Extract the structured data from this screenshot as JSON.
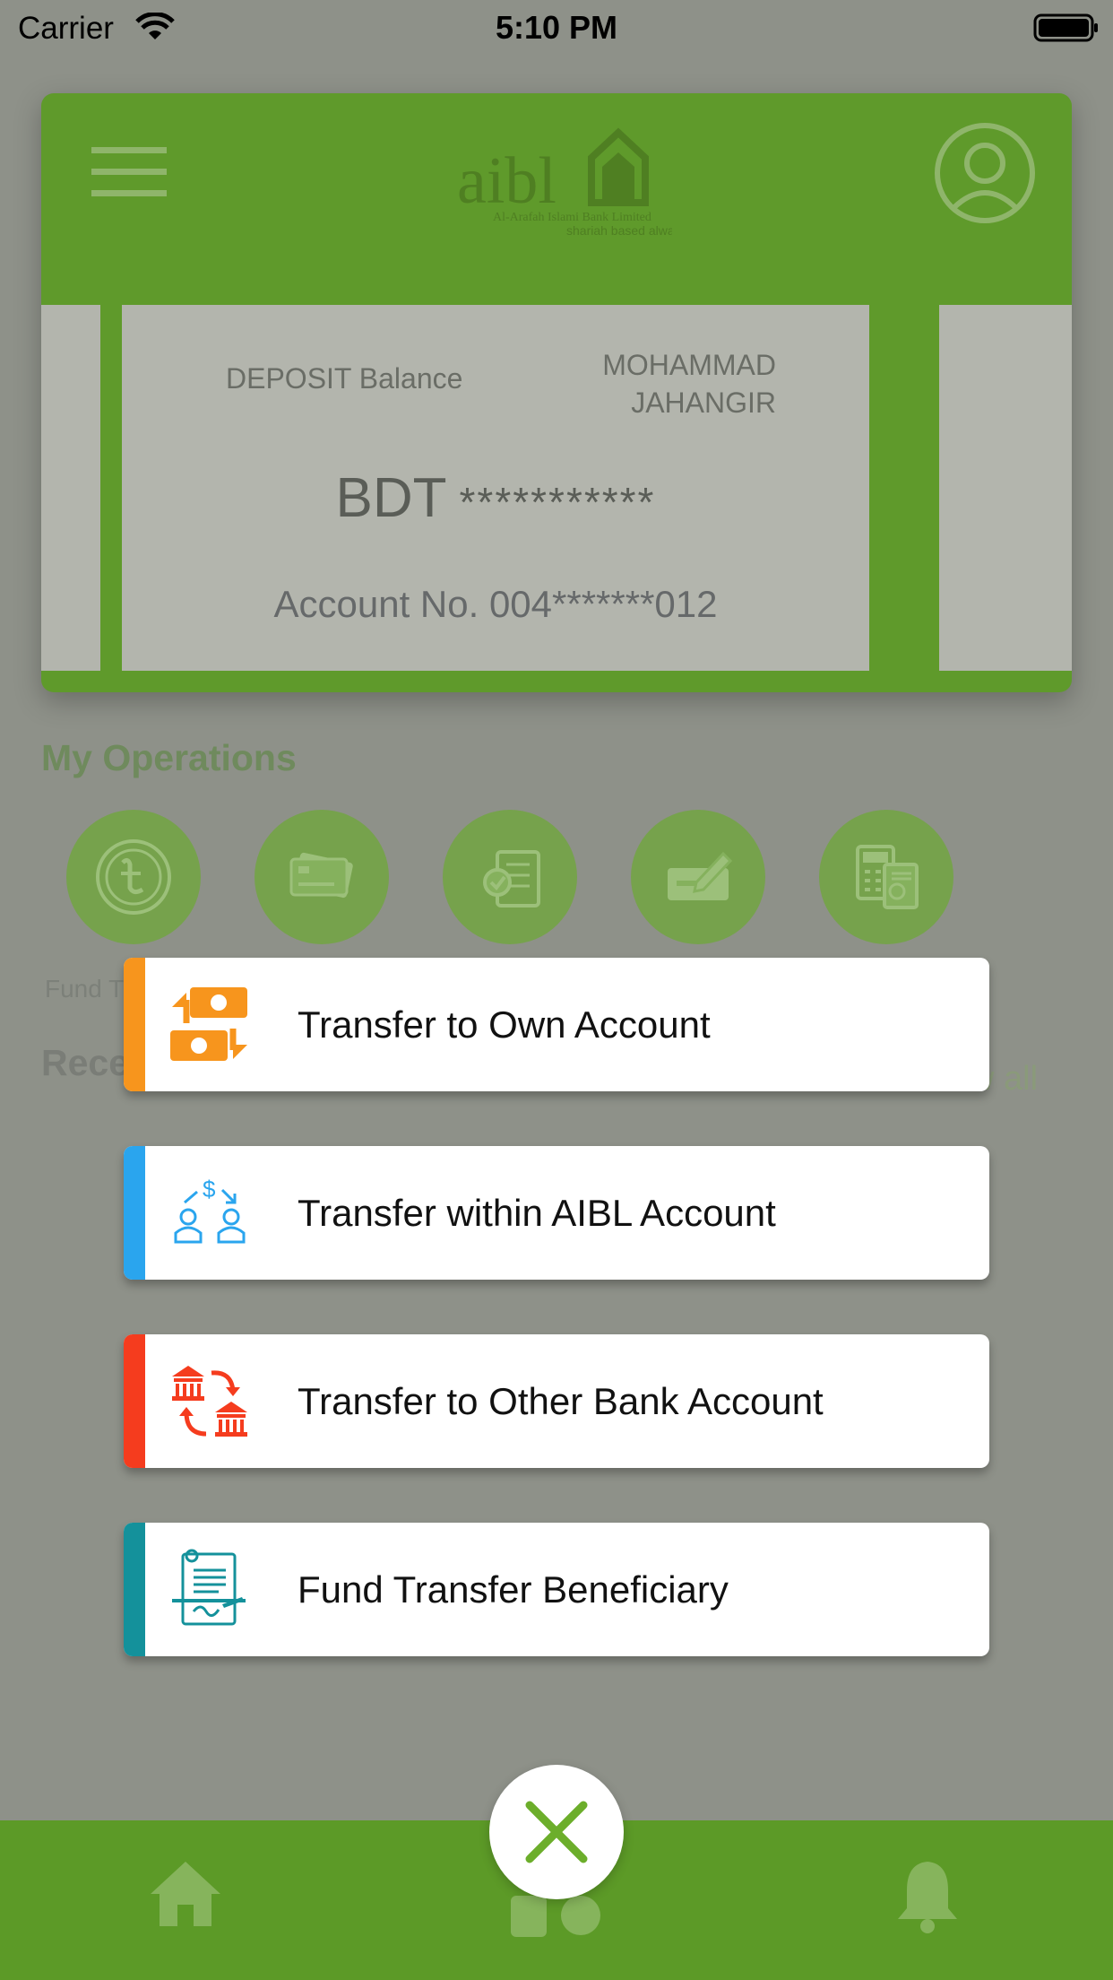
{
  "status_bar": {
    "carrier": "Carrier",
    "time": "5:10 PM"
  },
  "header": {
    "logo_text": "aibl",
    "logo_subtitle": "Al-Arafah Islami Bank Limited",
    "logo_tagline": "shariah based always"
  },
  "account_card": {
    "balance_label": "DEPOSIT Balance",
    "holder_name_line1": "MOHAMMAD",
    "holder_name_line2": "JAHANGIR",
    "currency": "BDT",
    "balance_masked": "***********",
    "account_no": "Account No. 004*******012"
  },
  "operations": {
    "title": "My Operations",
    "items": [
      {
        "icon": "taka-coin-icon"
      },
      {
        "icon": "credit-card-icon"
      },
      {
        "icon": "bill-check-icon"
      },
      {
        "icon": "cheque-pen-icon"
      },
      {
        "icon": "calculator-document-icon"
      }
    ],
    "first_label_partial": "Fund T"
  },
  "recent": {
    "title_partial": "Rece",
    "view_all_partial": "w all"
  },
  "transfer_options": [
    {
      "label": "Transfer to Own Account",
      "accent": "#f7951d",
      "icon": "money-exchange-icon"
    },
    {
      "label": "Transfer within AIBL Account",
      "accent": "#2aa5ee",
      "icon": "people-transfer-icon"
    },
    {
      "label": "Transfer to Other Bank Account",
      "accent": "#f53c1e",
      "icon": "bank-exchange-icon"
    },
    {
      "label": "Fund Transfer Beneficiary",
      "accent": "#14919b",
      "icon": "beneficiary-document-icon"
    }
  ],
  "colors": {
    "brand_green": "#6cae2b",
    "overlay": "#8e9189"
  }
}
